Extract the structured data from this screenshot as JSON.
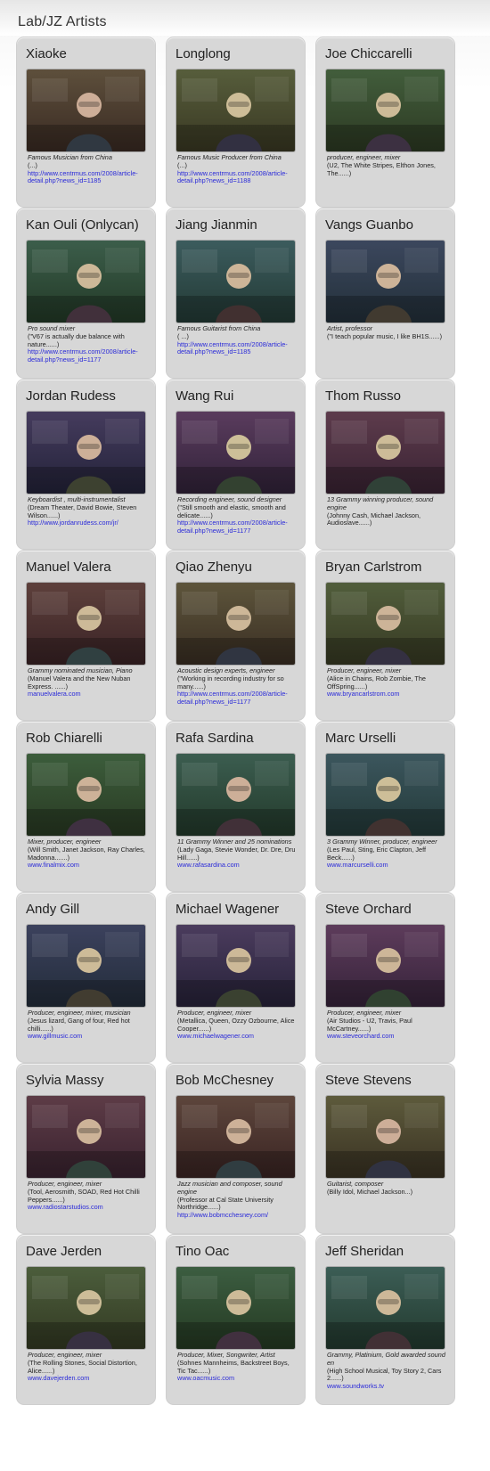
{
  "section": {
    "title": "Lab/JZ Artists"
  },
  "artists": [
    {
      "name": "Xiaoke",
      "role": "Famous Musician from China",
      "desc": "(...)",
      "link": "http://www.centrmus.com/2008/article-detail.php?news_id=1185",
      "photo": "studio-portrait"
    },
    {
      "name": "Longlong",
      "role": "Famous Music Producer from China",
      "desc": "(...)",
      "link": "http://www.centrmus.com/2008/article-detail.php?news_id=1188",
      "photo": "studio-portrait"
    },
    {
      "name": "Joe Chiccarelli",
      "role": "producer, engineer, mixer",
      "desc": "(U2, The White Stripes, Elthon Jones, The......)",
      "link": "",
      "photo": "studio-portrait"
    },
    {
      "name": "Kan Ouli (Onlycan)",
      "role": "Pro sound mixer",
      "desc": "(\"V67 is actually due balance with nature......)",
      "link": "http://www.centrmus.com/2008/article-detail.php?news_id=1177",
      "photo": "studio-portrait"
    },
    {
      "name": "Jiang Jianmin",
      "role": "Famous Guitarist from China",
      "desc": "( ...)",
      "link": "http://www.centrmus.com/2008/article-detail.php?news_id=1185",
      "photo": "studio-portrait"
    },
    {
      "name": "Vangs Guanbo",
      "role": "Artist, professor",
      "desc": "(\"I teach popular music, I like BH1S......)",
      "link": "",
      "photo": "studio-portrait"
    },
    {
      "name": "Jordan Rudess",
      "role": "Keyboardist , multi-instrumentalist",
      "desc": "(Dream Theater, David Bowie, Steven Wilson......)",
      "link": "http://www.jordanrudess.com/jr/",
      "photo": "studio-portrait"
    },
    {
      "name": "Wang Rui",
      "role": "Recording engineer, sound designer",
      "desc": "(\"Still smooth and elastic, smooth and delicate......)",
      "link": "http://www.centrmus.com/2008/article-detail.php?news_id=1177",
      "photo": "studio-portrait"
    },
    {
      "name": "Thom Russo",
      "role": "13 Grammy winning producer, sound engine",
      "desc": "(Johnny Cash, Michael Jackson, Audioslave......)",
      "link": "",
      "photo": "studio-portrait"
    },
    {
      "name": "Manuel Valera",
      "role": "Grammy nominated musician, Piano",
      "desc": "(Manuel Valera and the New Nuban Express. ......)",
      "link": "manuelvalera.com",
      "photo": "studio-portrait"
    },
    {
      "name": "Qiao Zhenyu",
      "role": "Acoustic design experts, engineer",
      "desc": "(\"Working in recording industry for so many......)",
      "link": "http://www.centrmus.com/2008/article-detail.php?news_id=1177",
      "photo": "studio-portrait"
    },
    {
      "name": "Bryan Carlstrom",
      "role": "Producer, engineer, mixer",
      "desc": "(Alice in Chains, Rob Zombie, The OffSpring......)",
      "link": "www.bryancarlstrom.com",
      "photo": "studio-portrait"
    },
    {
      "name": "Rob Chiarelli",
      "role": "Mixer, producer, engineer",
      "desc": "(Will Smith, Janet Jackson, Ray Charles, Madonna.......)",
      "link": "www.finalmix.com",
      "photo": "studio-portrait"
    },
    {
      "name": "Rafa Sardina",
      "role": "11 Grammy Winner and 25 nominations",
      "desc": "(Lady Gaga, Stevie Wonder, Dr. Dre, Dru Hill......)",
      "link": "www.rafasardina.com",
      "photo": "studio-portrait"
    },
    {
      "name": "Marc Urselli",
      "role": "3 Grammy Winner, producer, engineer",
      "desc": "(Les Paul, Sting, Eric Clapton, Jeff Beck......)",
      "link": "www.marcurselli.com",
      "photo": "studio-portrait"
    },
    {
      "name": "Andy Gill",
      "role": "Producer, engineer, mixer, musician",
      "desc": "(Jesus lizard, Gang of four, Red hot chilli......)",
      "link": "www.gillmusic.com",
      "photo": "studio-portrait"
    },
    {
      "name": "Michael Wagener",
      "role": "Producer, engineer, mixer",
      "desc": "(Metallica, Queen, Ozzy Ozbourne, Alice Cooper......)",
      "link": "www.michaelwagener.com",
      "photo": "studio-portrait"
    },
    {
      "name": "Steve Orchard",
      "role": "Producer, engineer, mixer",
      "desc": "(Air Studios - U2, Travis, Paul McCartney......)",
      "link": "www.steveorchard.com",
      "photo": "studio-portrait"
    },
    {
      "name": "Sylvia Massy",
      "role": "Producer, engineer, mixer",
      "desc": "(Tool, Aerosmith, SOAD, Red Hot Chilli Peppers......)",
      "link": "www.radiostarstudios.com",
      "photo": "studio-portrait"
    },
    {
      "name": "Bob McChesney",
      "role": "Jazz musician and composer, sound engine",
      "desc": "(Professor at Cal State University Northridge......)",
      "link": "http://www.bobmcchesney.com/",
      "photo": "studio-portrait"
    },
    {
      "name": "Steve Stevens",
      "role": "Guitarist, composer",
      "desc": "(Billy Idol, Michael Jackson...)",
      "link": "",
      "photo": "studio-portrait"
    },
    {
      "name": "Dave Jerden",
      "role": "Producer, engineer, mixer",
      "desc": "(The Rolling Stones, Social Distortion, Alice......)",
      "link": "www.davejerden.com",
      "photo": "studio-portrait"
    },
    {
      "name": "Tino Oac",
      "role": "Producer, Mixer, Songwriter, Artist",
      "desc": "(Sohnes Mannheims, Backstreet Boys, Tic Tac......)",
      "link": "www.oacmusic.com",
      "photo": "studio-portrait"
    },
    {
      "name": "Jeff Sheridan",
      "role": "Grammy, Platinium, Gold awarded sound en",
      "desc": "(High School Musical, Toy Story 2, Cars 2......)",
      "link": "www.soundworks.tv",
      "photo": "studio-portrait"
    }
  ],
  "colors": {
    "card_bg": "#d7d7d7",
    "link": "#2a2ad8",
    "text": "#222222"
  }
}
